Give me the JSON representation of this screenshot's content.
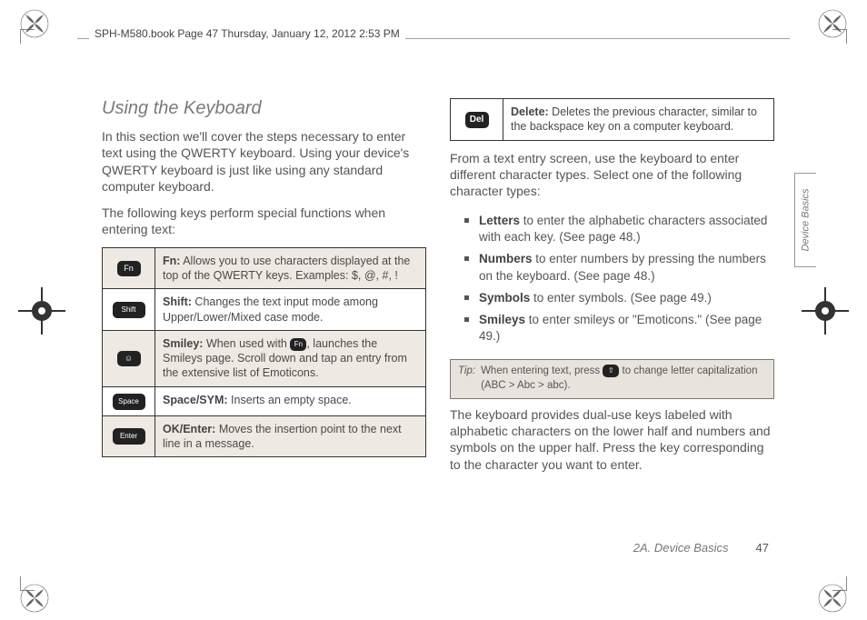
{
  "header": "SPH-M580.book  Page 47  Thursday, January 12, 2012  2:53 PM",
  "sidetab": "Device Basics",
  "footer": {
    "section": "2A. Device Basics",
    "page": "47"
  },
  "left": {
    "title": "Using the Keyboard",
    "p1": "In this section we'll cover the steps necessary to enter text using the QWERTY keyboard. Using your device's QWERTY keyboard is just like using any standard computer keyboard.",
    "p2": "The following keys perform special functions when entering text:",
    "rows": [
      {
        "icon": "Fn",
        "label": "Fn:",
        "desc": " Allows you to use characters displayed at the top of the QWERTY keys. Examples: $, @, #, !"
      },
      {
        "icon": "Shift",
        "label": "Shift:",
        "desc": " Changes the text input mode among Upper/Lower/Mixed case mode."
      },
      {
        "icon": "☺",
        "label": "Smiley:",
        "desc_a": " When used with ",
        "desc_b": ", launches the Smileys page. Scroll down and tap an entry from the extensive list of Emoticons."
      },
      {
        "icon": "Space",
        "label": "Space/SYM:",
        "desc": " Inserts an empty space."
      },
      {
        "icon": "Enter",
        "label": "OK/Enter:",
        "desc": " Moves the insertion point to the next line in a message."
      }
    ]
  },
  "right": {
    "delrow": {
      "icon": "Del",
      "label": "Delete:",
      "desc": " Deletes the previous character, similar to the backspace key on a computer keyboard."
    },
    "p1": "From a text entry screen, use the keyboard to enter different character types. Select one of the following character types:",
    "items": [
      {
        "b": "Letters",
        "t": " to enter the alphabetic characters associated with each key. (See page 48.)"
      },
      {
        "b": "Numbers",
        "t": " to enter numbers by pressing the numbers on the keyboard. (See page 48.)"
      },
      {
        "b": "Symbols",
        "t": " to enter symbols. (See page 49.)"
      },
      {
        "b": "Smileys",
        "t": " to enter smileys or \"Emoticons.\" (See page 49.)"
      }
    ],
    "tip": {
      "label": "Tip:",
      "a": "When entering text, press ",
      "b": " to change letter capitalization (ABC > Abc > abc)."
    },
    "p2": "The keyboard provides dual-use keys labeled with alphabetic characters on the lower half and numbers and symbols on the upper half. Press the key corresponding to the character you want to enter."
  }
}
